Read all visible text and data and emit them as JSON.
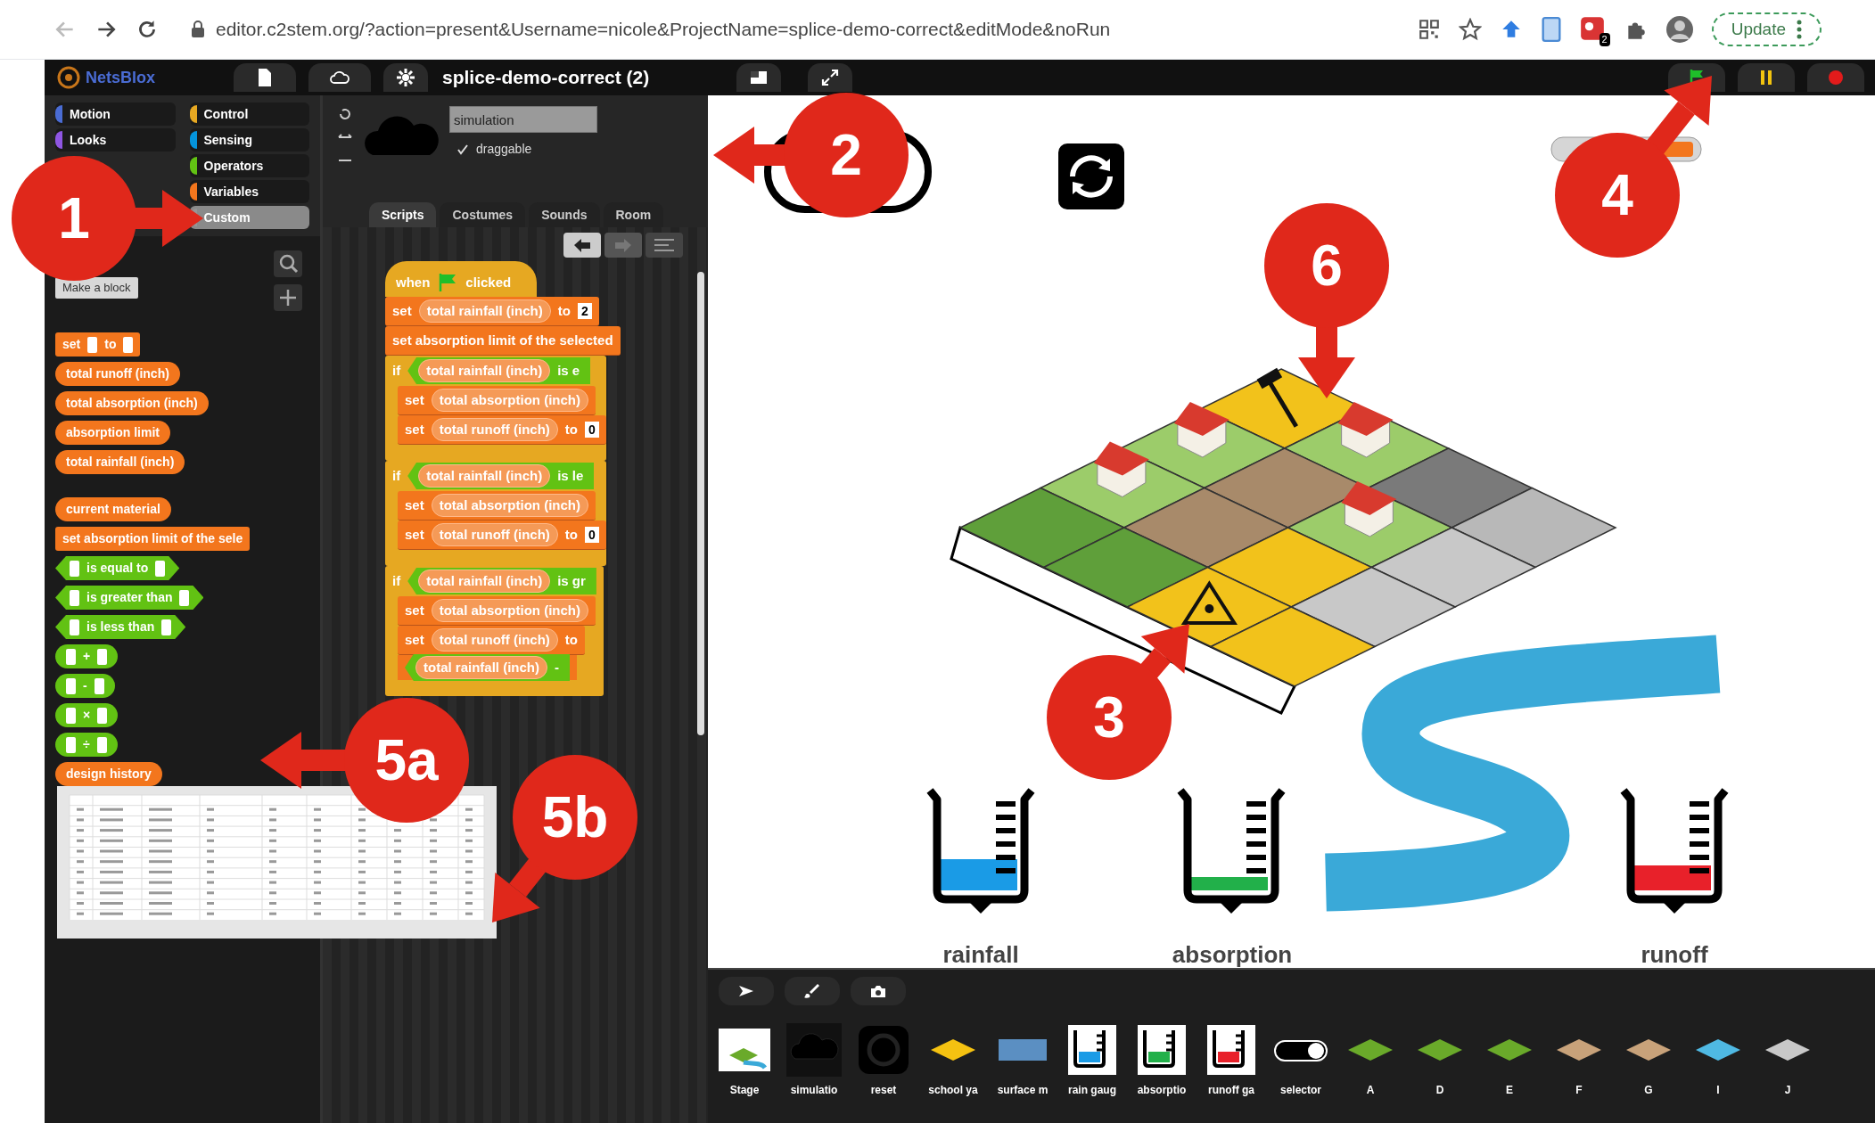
{
  "browser": {
    "url": "editor.c2stem.org/?action=present&Username=nicole&ProjectName=splice-demo-correct&editMode&noRun",
    "extension_badge": "2",
    "update_button": "Update"
  },
  "app_bar": {
    "logo": "NetsBlox",
    "project_title": "splice-demo-correct (2)"
  },
  "palette": {
    "left_categories": [
      {
        "label": "Motion",
        "color": "#4a6cd4",
        "selected": false
      },
      {
        "label": "Looks",
        "color": "#8f56e3",
        "selected": false
      }
    ],
    "right_categories": [
      {
        "label": "Control",
        "color": "#e6a822",
        "selected": false
      },
      {
        "label": "Sensing",
        "color": "#0494dc",
        "selected": false
      },
      {
        "label": "Operators",
        "color": "#62c213",
        "selected": false
      },
      {
        "label": "Variables",
        "color": "#f3761d",
        "selected": false
      },
      {
        "label": "Custom",
        "color": "#969696",
        "selected": true
      }
    ],
    "make_block_button": "Make a block",
    "blocks": [
      {
        "kind": "command",
        "parts": [
          {
            "kind": "text",
            "text": "set"
          },
          {
            "kind": "slot"
          },
          {
            "kind": "text",
            "text": "to"
          },
          {
            "kind": "slot"
          }
        ]
      },
      {
        "kind": "reporter",
        "parts": [
          {
            "kind": "text",
            "text": "total runoff (inch)"
          }
        ]
      },
      {
        "kind": "reporter",
        "parts": [
          {
            "kind": "text",
            "text": "total absorption (inch)"
          }
        ]
      },
      {
        "kind": "reporter",
        "parts": [
          {
            "kind": "text",
            "text": "absorption limit"
          }
        ]
      },
      {
        "kind": "reporter",
        "parts": [
          {
            "kind": "text",
            "text": "total rainfall (inch)"
          }
        ]
      },
      {
        "kind": "reporter",
        "gap": true,
        "parts": [
          {
            "kind": "text",
            "text": "current material"
          }
        ]
      },
      {
        "kind": "command",
        "parts": [
          {
            "kind": "text",
            "text": "set absorption limit of the sele"
          }
        ]
      },
      {
        "kind": "predicate",
        "parts": [
          {
            "kind": "slot"
          },
          {
            "kind": "text",
            "text": "is equal to"
          },
          {
            "kind": "slot"
          }
        ]
      },
      {
        "kind": "predicate",
        "parts": [
          {
            "kind": "slot"
          },
          {
            "kind": "text",
            "text": "is greater than"
          },
          {
            "kind": "slot"
          }
        ]
      },
      {
        "kind": "predicate",
        "parts": [
          {
            "kind": "slot"
          },
          {
            "kind": "text",
            "text": "is less than"
          },
          {
            "kind": "slot"
          }
        ]
      },
      {
        "kind": "operator",
        "parts": [
          {
            "kind": "slot"
          },
          {
            "kind": "text",
            "text": "+"
          },
          {
            "kind": "slot"
          }
        ]
      },
      {
        "kind": "operator",
        "parts": [
          {
            "kind": "slot"
          },
          {
            "kind": "text",
            "text": "-"
          },
          {
            "kind": "slot"
          }
        ]
      },
      {
        "kind": "operator",
        "parts": [
          {
            "kind": "slot"
          },
          {
            "kind": "text",
            "text": "×"
          },
          {
            "kind": "slot"
          }
        ]
      },
      {
        "kind": "operator",
        "parts": [
          {
            "kind": "slot"
          },
          {
            "kind": "text",
            "text": "÷"
          },
          {
            "kind": "slot"
          }
        ]
      },
      {
        "kind": "reporter",
        "parts": [
          {
            "kind": "text",
            "text": "design history"
          }
        ]
      }
    ]
  },
  "sprite": {
    "name": "simulation",
    "draggable": true,
    "draggable_label": "draggable"
  },
  "tabs": [
    {
      "label": "Scripts",
      "selected": true
    },
    {
      "label": "Costumes",
      "selected": false
    },
    {
      "label": "Sounds",
      "selected": false
    },
    {
      "label": "Room",
      "selected": false
    }
  ],
  "script": [
    {
      "kind": "hat",
      "parts": [
        {
          "kind": "text",
          "text": "when"
        },
        {
          "kind": "flag"
        },
        {
          "kind": "text",
          "text": "clicked"
        }
      ]
    },
    {
      "kind": "command",
      "parts": [
        {
          "kind": "text",
          "text": "set"
        },
        {
          "kind": "var",
          "text": "total rainfall (inch)"
        },
        {
          "kind": "text",
          "text": "to"
        },
        {
          "kind": "value",
          "text": "2"
        }
      ]
    },
    {
      "kind": "command",
      "parts": [
        {
          "kind": "text",
          "text": "set absorption limit of the selected"
        }
      ]
    },
    {
      "kind": "if",
      "parts": [
        {
          "kind": "text",
          "text": "if"
        },
        {
          "kind": "pred",
          "parts": [
            {
              "kind": "var",
              "text": "total rainfall (inch)"
            },
            {
              "kind": "text",
              "text": "is e"
            }
          ]
        }
      ],
      "children": [
        {
          "kind": "command",
          "parts": [
            {
              "kind": "text",
              "text": "set"
            },
            {
              "kind": "var",
              "text": "total absorption (inch)"
            }
          ]
        },
        {
          "kind": "command",
          "parts": [
            {
              "kind": "text",
              "text": "set"
            },
            {
              "kind": "var",
              "text": "total runoff (inch)"
            },
            {
              "kind": "text",
              "text": "to"
            },
            {
              "kind": "value",
              "text": "0"
            }
          ]
        }
      ]
    },
    {
      "kind": "if",
      "parts": [
        {
          "kind": "text",
          "text": "if"
        },
        {
          "kind": "pred",
          "parts": [
            {
              "kind": "var",
              "text": "total rainfall (inch)"
            },
            {
              "kind": "text",
              "text": "is le"
            }
          ]
        }
      ],
      "children": [
        {
          "kind": "command",
          "parts": [
            {
              "kind": "text",
              "text": "set"
            },
            {
              "kind": "var",
              "text": "total absorption (inch)"
            }
          ]
        },
        {
          "kind": "command",
          "parts": [
            {
              "kind": "text",
              "text": "set"
            },
            {
              "kind": "var",
              "text": "total runoff (inch)"
            },
            {
              "kind": "text",
              "text": "to"
            },
            {
              "kind": "value",
              "text": "0"
            }
          ]
        }
      ]
    },
    {
      "kind": "if",
      "parts": [
        {
          "kind": "text",
          "text": "if"
        },
        {
          "kind": "pred",
          "parts": [
            {
              "kind": "var",
              "text": "total rainfall (inch)"
            },
            {
              "kind": "text",
              "text": "is gr"
            }
          ]
        }
      ],
      "children": [
        {
          "kind": "command",
          "parts": [
            {
              "kind": "text",
              "text": "set"
            },
            {
              "kind": "var",
              "text": "total absorption (inch)"
            }
          ]
        },
        {
          "kind": "command",
          "parts": [
            {
              "kind": "text",
              "text": "set"
            },
            {
              "kind": "var",
              "text": "total runoff (inch)"
            },
            {
              "kind": "text",
              "text": "to"
            }
          ]
        },
        {
          "kind": "continuation",
          "parts": [
            {
              "kind": "pred",
              "parts": [
                {
                  "kind": "var",
                  "text": "total rainfall (inch)"
                },
                {
                  "kind": "text",
                  "text": "-"
                }
              ]
            }
          ]
        }
      ]
    }
  ],
  "stage": {
    "meters": [
      {
        "label": "rainfall",
        "color": "#1a9be6",
        "level": 0.35
      },
      {
        "label": "absorption",
        "color": "#22b04a",
        "level": 0.15
      },
      {
        "label": "runoff",
        "color": "#e8212a",
        "level": 0.28
      }
    ]
  },
  "corral": {
    "sprites": [
      {
        "name": "Stage",
        "kind": "stage"
      },
      {
        "name": "simulatio",
        "kind": "cloud"
      },
      {
        "name": "reset",
        "kind": "refresh"
      },
      {
        "name": "school ya",
        "kind": "diamond",
        "color": "#f5c211"
      },
      {
        "name": "surface m",
        "kind": "rect",
        "color": "#5b8fc2"
      },
      {
        "name": "rain gaug",
        "kind": "beaker",
        "color": "#1a9be6"
      },
      {
        "name": "absorptio",
        "kind": "beaker",
        "color": "#22b04a"
      },
      {
        "name": "runoff ga",
        "kind": "beaker",
        "color": "#e8212a"
      },
      {
        "name": "selector",
        "kind": "toggle"
      },
      {
        "name": "A",
        "kind": "diamond",
        "color": "#6aaa2a"
      },
      {
        "name": "D",
        "kind": "diamond",
        "color": "#6aaa2a"
      },
      {
        "name": "E",
        "kind": "diamond",
        "color": "#6aaa2a"
      },
      {
        "name": "F",
        "kind": "diamond",
        "color": "#c8a27a"
      },
      {
        "name": "G",
        "kind": "diamond",
        "color": "#c8a27a"
      },
      {
        "name": "I",
        "kind": "diamond",
        "color": "#4fb9e3"
      },
      {
        "name": "J",
        "kind": "diamond",
        "color": "#c8c8c8"
      }
    ]
  },
  "annotations": [
    {
      "label": "1"
    },
    {
      "label": "2"
    },
    {
      "label": "3"
    },
    {
      "label": "4"
    },
    {
      "label": "5a"
    },
    {
      "label": "5b"
    },
    {
      "label": "6"
    }
  ]
}
